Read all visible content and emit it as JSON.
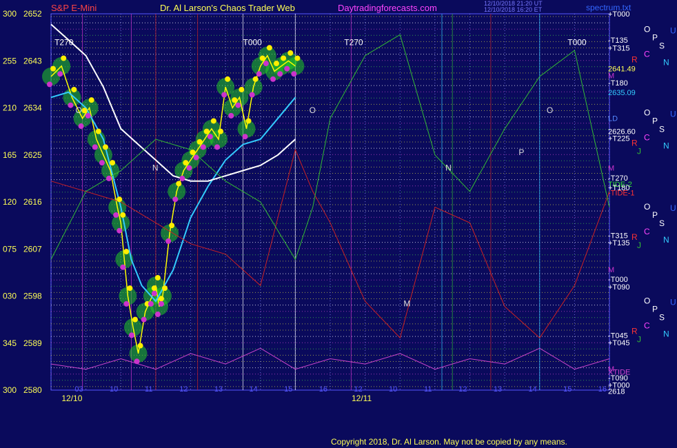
{
  "header": {
    "symbol": "S&P E-Mini",
    "site": "Dr. Al Larson's Chaos Trader Web",
    "url": "Daytradingforecasts.com",
    "stamp1": "12/10/2018 21:20 UT",
    "stamp2": "12/10/2018 16:20 ET",
    "brand": "spectrum.txt"
  },
  "footer": {
    "copyright": "Copyright 2018, Dr. Al Larson. May not be copied by any means."
  },
  "colors": {
    "background": "#0a0a5c",
    "plot_border": "#5555ff",
    "price_labels": "#ffff55",
    "ema_fast": "#33ccff",
    "ema_slow": "#ffffff",
    "price": "#ffff00",
    "tide": "#cc2222",
    "tide2": "#33bb33",
    "xtide": "#cc44cc",
    "cloud": "#22cc22",
    "bubble_high": "#ffee00",
    "bubble_low": "#cc33cc"
  },
  "chart_data": {
    "type": "line",
    "title": "S&P E-Mini",
    "y_axis": {
      "angle_labels": [
        "300",
        "255",
        "210",
        "165",
        "120",
        "075",
        "030",
        "345",
        "300"
      ],
      "price_labels": [
        "2652",
        "2643",
        "2634",
        "2625",
        "2616",
        "2607",
        "2598",
        "2589",
        "2580"
      ],
      "ylim": [
        2580,
        2652
      ]
    },
    "x_axis": {
      "hours_day1": [
        "03",
        "10",
        "11",
        "12",
        "13",
        "14",
        "15",
        "16"
      ],
      "hours_day2": [
        "12",
        "10",
        "11",
        "12",
        "13",
        "14",
        "15",
        "16"
      ],
      "dates": [
        "12/10",
        "12/11"
      ],
      "xlim": [
        9,
        25
      ]
    },
    "series": [
      {
        "name": "price",
        "x": [
          9.0,
          9.3,
          9.6,
          9.9,
          10.1,
          10.3,
          10.5,
          10.7,
          10.9,
          11.0,
          11.1,
          11.2,
          11.35,
          11.5,
          11.7,
          11.9,
          12.0,
          12.1,
          12.2,
          12.4,
          12.6,
          12.8,
          13.0,
          13.2,
          13.4,
          13.6,
          13.8,
          14.0,
          14.2,
          14.4,
          14.6,
          14.8,
          15.0,
          15.2,
          15.4,
          15.6,
          15.8,
          16.0
        ],
        "y": [
          2640,
          2642,
          2636,
          2632,
          2634,
          2628,
          2625,
          2622,
          2615,
          2612,
          2605,
          2598,
          2592,
          2587,
          2595,
          2598,
          2600,
          2596,
          2598,
          2610,
          2618,
          2622,
          2624,
          2626,
          2628,
          2630,
          2628,
          2638,
          2634,
          2636,
          2630,
          2638,
          2642,
          2644,
          2641,
          2642,
          2643,
          2642
        ]
      },
      {
        "name": "ema-fast",
        "x": [
          9.0,
          9.5,
          10.0,
          10.5,
          11.0,
          11.3,
          11.6,
          12.0,
          12.5,
          13.0,
          13.5,
          14.0,
          14.5,
          15.0,
          15.5,
          16.0
        ],
        "y": [
          2636,
          2637,
          2634,
          2628,
          2615,
          2605,
          2600,
          2597,
          2603,
          2613,
          2619,
          2624,
          2627,
          2628,
          2632,
          2636
        ]
      },
      {
        "name": "ema-slow",
        "x": [
          9.0,
          9.5,
          10.0,
          10.5,
          11.0,
          11.5,
          12.0,
          12.5,
          13.0,
          13.5,
          14.0,
          14.5,
          15.0,
          15.5,
          16.0
        ],
        "y": [
          2650,
          2647,
          2644,
          2638,
          2630,
          2627,
          2624,
          2621,
          2620,
          2620,
          2621,
          2622,
          2623,
          2625,
          2628
        ]
      },
      {
        "name": "TIDE-1",
        "x": [
          9.0,
          10.0,
          11.0,
          12.0,
          13.0,
          14.0,
          15.0,
          16.0,
          16.5,
          17.0,
          18.0,
          19.0,
          20.0,
          21.0,
          22.0,
          23.0,
          24.0,
          25.0
        ],
        "y": [
          2620,
          2618,
          2616,
          2612,
          2608,
          2606,
          2600,
          2626,
          2618,
          2612,
          2597,
          2590,
          2615,
          2612,
          2596,
          2590,
          2600,
          2618
        ]
      },
      {
        "name": "TIDE-2",
        "x": [
          9.0,
          10.0,
          11.0,
          12.0,
          13.0,
          14.0,
          15.0,
          16.0,
          16.5,
          17.0,
          18.0,
          19.0,
          20.0,
          21.0,
          22.0,
          23.0,
          24.0,
          25.0
        ],
        "y": [
          2605,
          2618,
          2622,
          2628,
          2626,
          2620,
          2616,
          2605,
          2615,
          2632,
          2644,
          2648,
          2625,
          2618,
          2630,
          2640,
          2645,
          2615
        ]
      },
      {
        "name": "XTIDE",
        "x": [
          9.0,
          10.0,
          11.0,
          12.0,
          13.0,
          14.0,
          15.0,
          16.0,
          17.0,
          18.0,
          19.0,
          20.0,
          21.0,
          22.0,
          23.0,
          24.0,
          25.0
        ],
        "y": [
          2585,
          2584,
          2586,
          2584,
          2587,
          2585,
          2588,
          2584,
          2586,
          2585,
          2587,
          2584,
          2586,
          2585,
          2588,
          2584,
          2586
        ]
      }
    ],
    "right_labels": [
      {
        "text": "+T000",
        "color": "#ffffff",
        "y": 2652
      },
      {
        "text": "-T135",
        "color": "#ffffff",
        "y": 2647
      },
      {
        "text": "+T315",
        "color": "#ffffff",
        "y": 2645.5
      },
      {
        "text": "2641.49",
        "color": "#ffff55",
        "y": 2641.5
      },
      {
        "text": "M",
        "color": "#cc33cc",
        "y": 2640.2
      },
      {
        "text": "-T180",
        "color": "#ffffff",
        "y": 2638.8
      },
      {
        "text": "2635.09",
        "color": "#33ccff",
        "y": 2637
      },
      {
        "text": "LD",
        "color": "#5588ff",
        "y": 2632
      },
      {
        "text": "2626.60",
        "color": "#ffffff",
        "y": 2629.5
      },
      {
        "text": "+T225",
        "color": "#ffffff",
        "y": 2628.2
      },
      {
        "text": "M",
        "color": "#cc33cc",
        "y": 2622.5
      },
      {
        "text": "-T270",
        "color": "#ffffff",
        "y": 2620.6
      },
      {
        "text": "TIDE-2",
        "color": "#33dd33",
        "y": 2619.4
      },
      {
        "text": "+T180",
        "color": "#ffffff",
        "y": 2618.8
      },
      {
        "text": "-TIDE-1",
        "color": "#ff3333",
        "y": 2617.8
      },
      {
        "text": "-T315",
        "color": "#ffffff",
        "y": 2609.6
      },
      {
        "text": "+T135",
        "color": "#ffffff",
        "y": 2608.2
      },
      {
        "text": "M",
        "color": "#cc33cc",
        "y": 2603.1
      },
      {
        "text": "-T000",
        "color": "#ffffff",
        "y": 2601.2
      },
      {
        "text": "+T090",
        "color": "#ffffff",
        "y": 2599.8
      },
      {
        "text": "-T045",
        "color": "#ffffff",
        "y": 2590.5
      },
      {
        "text": "+T045",
        "color": "#ffffff",
        "y": 2589.1
      },
      {
        "text": "M",
        "color": "#cc33cc",
        "y": 2584.1
      },
      {
        "text": "XTIDE",
        "color": "#cc44cc",
        "y": 2583.5
      },
      {
        "text": "-T090",
        "color": "#ffffff",
        "y": 2582.4
      },
      {
        "text": "+T000",
        "color": "#ffffff",
        "y": 2581.0
      },
      {
        "text": "2618",
        "color": "#ffffff",
        "y": 2579.8
      }
    ],
    "planet_groups": [
      {
        "y": 2648,
        "letters": [
          "O",
          "P",
          "S",
          "C",
          "R",
          "N",
          "U"
        ]
      },
      {
        "y": 2632,
        "letters": [
          "O",
          "P",
          "S",
          "C",
          "R",
          "J",
          "N",
          "U"
        ]
      },
      {
        "y": 2614,
        "letters": [
          "O",
          "P",
          "S",
          "C",
          "R",
          "J",
          "N",
          "U"
        ]
      },
      {
        "y": 2596,
        "letters": [
          "O",
          "P",
          "S",
          "C",
          "R",
          "J",
          "N",
          "U"
        ]
      }
    ],
    "annotations": [
      {
        "text": "T270",
        "x": 9.1,
        "y": 2646
      },
      {
        "text": "T000",
        "x": 14.5,
        "y": 2646
      },
      {
        "text": "T270",
        "x": 17.4,
        "y": 2646
      },
      {
        "text": "T000",
        "x": 23.8,
        "y": 2646
      },
      {
        "text": "O",
        "x": 9.7,
        "y": 2633
      },
      {
        "text": "O",
        "x": 16.4,
        "y": 2633
      },
      {
        "text": "O",
        "x": 23.2,
        "y": 2633
      },
      {
        "text": "N",
        "x": 11.9,
        "y": 2622
      },
      {
        "text": "N",
        "x": 20.3,
        "y": 2622
      },
      {
        "text": "P",
        "x": 22.4,
        "y": 2625
      },
      {
        "text": "M",
        "x": 19.1,
        "y": 2596
      }
    ]
  }
}
